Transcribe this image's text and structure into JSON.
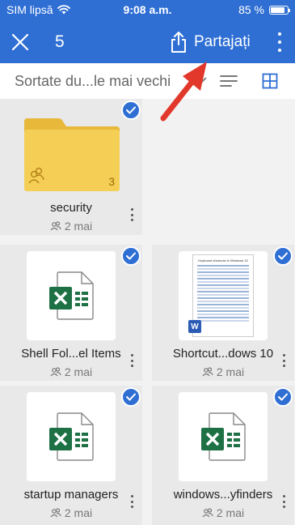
{
  "status": {
    "carrier": "SIM lipsă",
    "time": "9:08 a.m.",
    "battery": "85 %",
    "battery_level": 0.85
  },
  "appbar": {
    "selected_count": "5",
    "share_label": "Partajați"
  },
  "sortbar": {
    "sort_label": "Sortate du...le mai vechi"
  },
  "items": [
    {
      "name": "security",
      "type": "folder",
      "date": "2 mai",
      "folder_count": "3",
      "selected": true
    },
    {
      "name": "Shell Fol...el Items",
      "type": "excel",
      "date": "2 mai",
      "selected": true
    },
    {
      "name": "Shortcut...dows 10",
      "type": "word",
      "date": "2 mai",
      "selected": true,
      "preview_title": "Keyboard shortcuts in Windows 10"
    },
    {
      "name": "startup managers",
      "type": "excel",
      "date": "2 mai",
      "selected": true
    },
    {
      "name": "windows...yfinders",
      "type": "excel",
      "date": "2 mai",
      "selected": true
    }
  ],
  "colors": {
    "accent": "#2f6fd4",
    "folder": "#f5cf55",
    "excel": "#1e7145",
    "arrow": "#e2382b"
  }
}
